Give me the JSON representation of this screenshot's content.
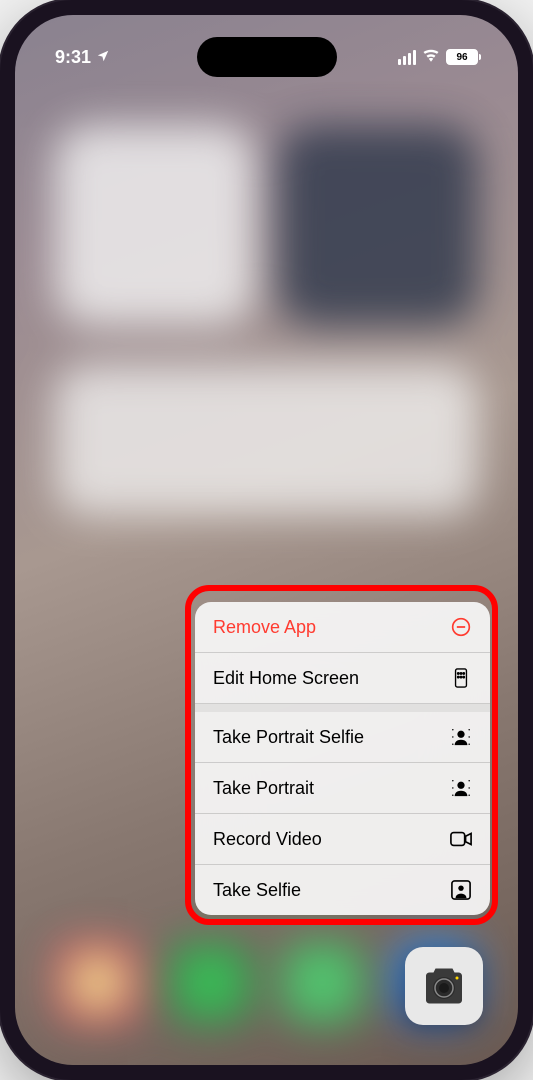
{
  "status": {
    "time": "9:31",
    "battery": "96"
  },
  "menu": {
    "remove": "Remove App",
    "edit": "Edit Home Screen",
    "portrait_selfie": "Take Portrait Selfie",
    "portrait": "Take Portrait",
    "record_video": "Record Video",
    "selfie": "Take Selfie"
  },
  "colors": {
    "destructive": "#ff3b30",
    "highlight": "#ff0000"
  }
}
